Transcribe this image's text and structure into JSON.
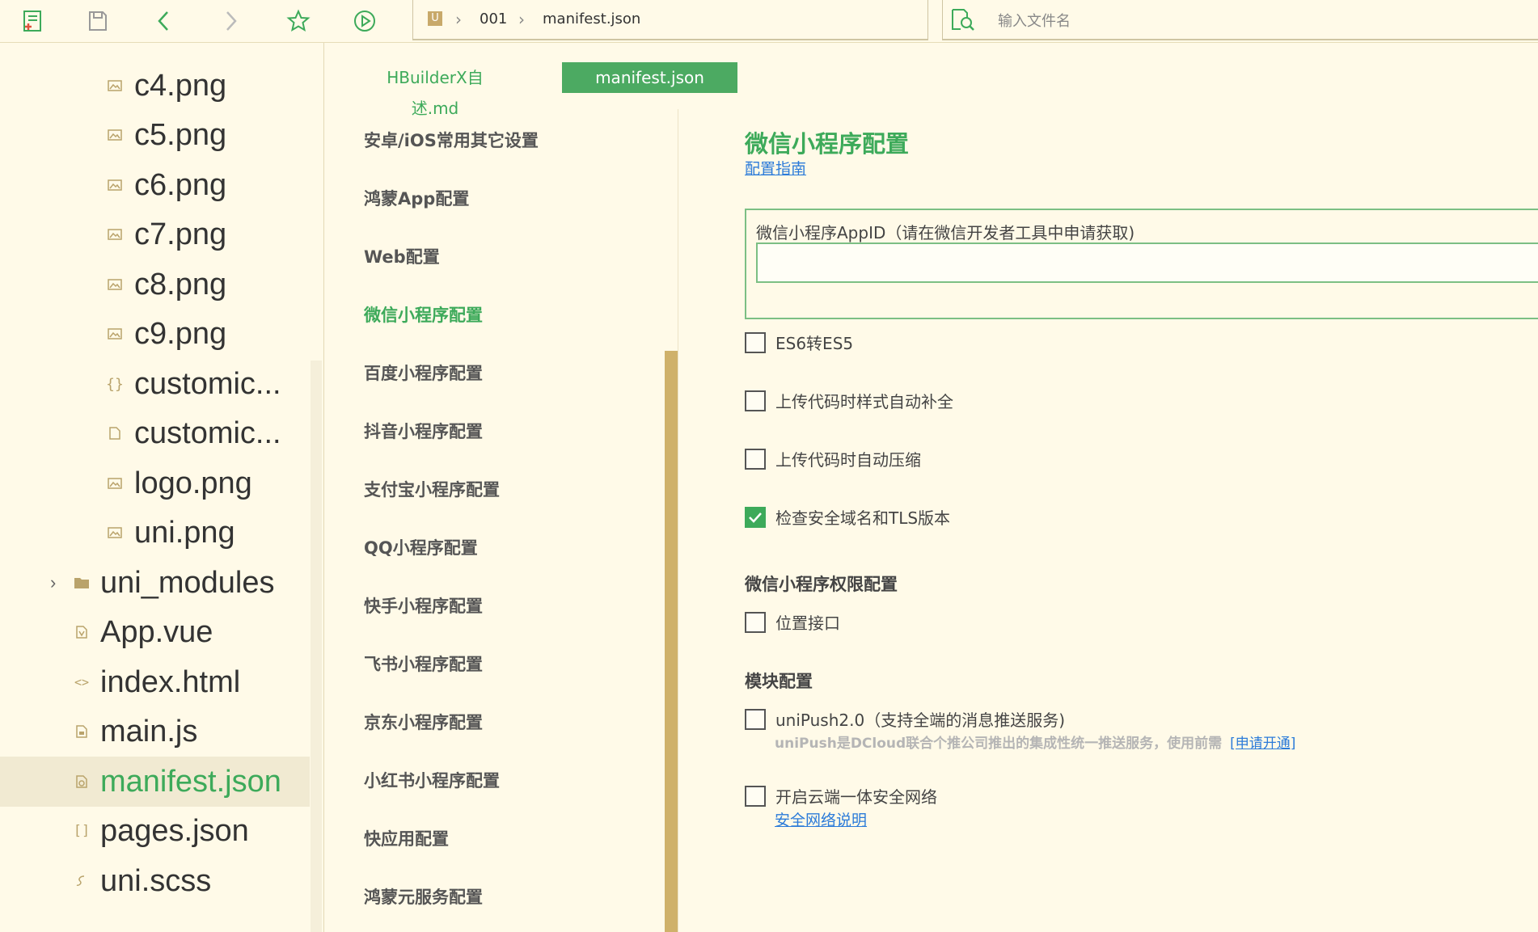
{
  "toolbar": {
    "buttons": [
      {
        "name": "new-file-icon"
      },
      {
        "name": "save-icon"
      },
      {
        "name": "back-icon"
      },
      {
        "name": "forward-icon"
      },
      {
        "name": "star-icon"
      },
      {
        "name": "run-icon"
      }
    ],
    "breadcrumb": {
      "project_badge": "U",
      "folder": "001",
      "file": "manifest.json"
    },
    "search": {
      "placeholder": "输入文件名"
    }
  },
  "sidebar": {
    "items": [
      {
        "label": "c4.png",
        "icon": "image-icon"
      },
      {
        "label": "c5.png",
        "icon": "image-icon"
      },
      {
        "label": "c6.png",
        "icon": "image-icon"
      },
      {
        "label": "c7.png",
        "icon": "image-icon"
      },
      {
        "label": "c8.png",
        "icon": "image-icon"
      },
      {
        "label": "c9.png",
        "icon": "image-icon"
      },
      {
        "label": "customic...",
        "icon": "json-file-icon"
      },
      {
        "label": "customic...",
        "icon": "file-icon"
      },
      {
        "label": "logo.png",
        "icon": "image-icon"
      },
      {
        "label": "uni.png",
        "icon": "image-icon"
      },
      {
        "label": "uni_modules",
        "icon": "folder-icon"
      },
      {
        "label": "App.vue",
        "icon": "vue-file-icon"
      },
      {
        "label": "index.html",
        "icon": "html-file-icon"
      },
      {
        "label": "main.js",
        "icon": "js-file-icon"
      },
      {
        "label": "manifest.json",
        "icon": "manifest-file-icon"
      },
      {
        "label": "pages.json",
        "icon": "json-bracket-icon"
      },
      {
        "label": "uni.scss",
        "icon": "scss-file-icon"
      }
    ],
    "active_item": "manifest.json"
  },
  "tabs": [
    {
      "label": "HBuilderX自述.md"
    },
    {
      "label": "manifest.json"
    }
  ],
  "settings_nav": {
    "items": [
      "安卓/iOS常用其它设置",
      "鸿蒙App配置",
      "Web配置",
      "微信小程序配置",
      "百度小程序配置",
      "抖音小程序配置",
      "支付宝小程序配置",
      "QQ小程序配置",
      "快手小程序配置",
      "飞书小程序配置",
      "京东小程序配置",
      "小红书小程序配置",
      "快应用配置",
      "鸿蒙元服务配置"
    ],
    "active": "微信小程序配置"
  },
  "content": {
    "title": "微信小程序配置",
    "guide_link": "配置指南",
    "appid_label": "微信小程序AppID（请在微信开发者工具中申请获取)",
    "appid_value": "",
    "checkboxes": [
      {
        "label": "ES6转ES5",
        "checked": false
      },
      {
        "label": "上传代码时样式自动补全",
        "checked": false
      },
      {
        "label": "上传代码时自动压缩",
        "checked": false
      },
      {
        "label": "检查安全域名和TLS版本",
        "checked": true
      }
    ],
    "permission_title": "微信小程序权限配置",
    "permission_location": "位置接口",
    "module_title": "模块配置",
    "unipush_label": "uniPush2.0（支持全端的消息推送服务)",
    "unipush_desc": "uniPush是DCloud联合个推公司推出的集成性统一推送服务，使用前需",
    "unipush_apply": "[申请开通]",
    "cloud_security_label": "开启云端一体安全网络",
    "cloud_security_link": "安全网络说明"
  },
  "colors": {
    "accent": "#3daa5a",
    "background": "#fffae8",
    "scrollbar": "#cfb16a",
    "link": "#2b7bd9"
  }
}
